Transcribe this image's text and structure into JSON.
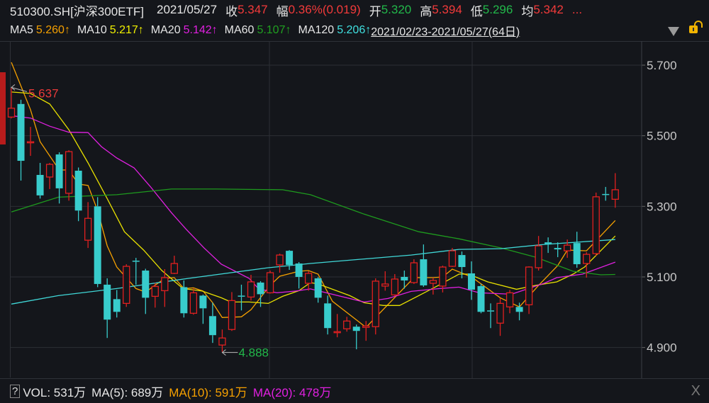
{
  "header": {
    "symbol": "510300.SH[沪深300ETF]",
    "date": "2021/05/27",
    "close_label": "收",
    "close": "5.347",
    "change_label": "幅",
    "change": "0.36%(0.019)",
    "open_label": "开",
    "open": "5.320",
    "high_label": "高",
    "high": "5.394",
    "low_label": "低",
    "low": "5.296",
    "avg_label": "均",
    "avg": "5.342",
    "more": "..."
  },
  "ma_legend": [
    {
      "label": "MA5",
      "value": "5.260↑",
      "color": "#f5a000"
    },
    {
      "label": "MA10",
      "value": "5.217↑",
      "color": "#f0f000"
    },
    {
      "label": "MA20",
      "value": "5.142↑",
      "color": "#e020e0"
    },
    {
      "label": "MA60",
      "value": "5.107↑",
      "color": "#20a020"
    },
    {
      "label": "MA120",
      "value": "5.206↑",
      "color": "#40e0e0"
    }
  ],
  "range": "2021/02/23-2021/05/27(64日)",
  "volume": {
    "help": "?",
    "vol": "VOL: 531万",
    "ma5": "MA(5): 689万",
    "ma10": "MA(10): 591万",
    "ma20": "MA(20): 478万",
    "close": "X"
  },
  "chart_data": {
    "type": "candlestick",
    "ylim": [
      4.83,
      5.77
    ],
    "yticks": [
      "5.700",
      "5.500",
      "5.300",
      "5.100",
      "4.900"
    ],
    "ytick_values": [
      5.7,
      5.5,
      5.3,
      5.1,
      4.9
    ],
    "annotations": {
      "max": "5.637",
      "min": "4.888",
      "max_index": 0,
      "min_index": 22
    },
    "up_color": "#e02020",
    "down_color": "#38cccc",
    "candles": [
      [
        5.553,
        5.637,
        5.549,
        5.578
      ],
      [
        5.59,
        5.602,
        5.373,
        5.429
      ],
      [
        5.483,
        5.525,
        5.443,
        5.483
      ],
      [
        5.389,
        5.423,
        5.322,
        5.331
      ],
      [
        5.383,
        5.423,
        5.349,
        5.419
      ],
      [
        5.447,
        5.453,
        5.308,
        5.351
      ],
      [
        5.337,
        5.459,
        5.316,
        5.455
      ],
      [
        5.401,
        5.41,
        5.258,
        5.288
      ],
      [
        5.204,
        5.312,
        5.182,
        5.266
      ],
      [
        5.3,
        5.326,
        5.071,
        5.08
      ],
      [
        5.078,
        5.096,
        4.927,
        4.979
      ],
      [
        5.037,
        5.063,
        4.985,
        5.001
      ],
      [
        5.025,
        5.136,
        5.015,
        5.13
      ],
      [
        5.146,
        5.154,
        5.078,
        5.144
      ],
      [
        5.118,
        5.123,
        4.995,
        5.041
      ],
      [
        5.045,
        5.083,
        5.013,
        5.073
      ],
      [
        5.061,
        5.122,
        5.015,
        5.098
      ],
      [
        5.11,
        5.16,
        5.108,
        5.138
      ],
      [
        5.071,
        5.09,
        4.985,
        4.997
      ],
      [
        4.997,
        5.067,
        4.993,
        5.055
      ],
      [
        5.047,
        5.05,
        4.967,
        5.011
      ],
      [
        4.989,
        5.027,
        4.913,
        4.935
      ],
      [
        4.907,
        4.951,
        4.888,
        4.927
      ],
      [
        4.951,
        5.057,
        4.947,
        5.033
      ],
      [
        5.047,
        5.078,
        5.005,
        5.045
      ],
      [
        5.043,
        5.106,
        5.033,
        5.086
      ],
      [
        5.084,
        5.088,
        5.015,
        5.051
      ],
      [
        5.055,
        5.118,
        5.053,
        5.112
      ],
      [
        5.134,
        5.166,
        5.112,
        5.162
      ],
      [
        5.174,
        5.176,
        5.12,
        5.134
      ],
      [
        5.138,
        5.142,
        5.067,
        5.1
      ],
      [
        5.082,
        5.116,
        5.061,
        5.11
      ],
      [
        5.096,
        5.1,
        5.027,
        5.041
      ],
      [
        5.025,
        5.047,
        4.937,
        4.955
      ],
      [
        4.943,
        4.995,
        4.929,
        4.945
      ],
      [
        4.953,
        4.987,
        4.945,
        4.975
      ],
      [
        4.959,
        4.965,
        4.895,
        4.947
      ],
      [
        4.957,
        4.975,
        4.919,
        4.961
      ],
      [
        4.959,
        5.096,
        4.937,
        5.088
      ],
      [
        5.074,
        5.116,
        5.061,
        5.08
      ],
      [
        5.049,
        5.108,
        5.045,
        5.094
      ],
      [
        5.1,
        5.118,
        5.067,
        5.09
      ],
      [
        5.084,
        5.15,
        5.08,
        5.14
      ],
      [
        5.15,
        5.192,
        5.072,
        5.076
      ],
      [
        5.082,
        5.098,
        5.05,
        5.09
      ],
      [
        5.074,
        5.132,
        5.056,
        5.128
      ],
      [
        5.13,
        5.182,
        5.128,
        5.174
      ],
      [
        5.162,
        5.172,
        5.096,
        5.128
      ],
      [
        5.11,
        5.144,
        5.035,
        5.064
      ],
      [
        5.074,
        5.08,
        4.997,
        5.001
      ],
      [
        5.005,
        5.025,
        4.955,
        5.003
      ],
      [
        4.969,
        5.04,
        4.933,
        5.025
      ],
      [
        5.015,
        5.063,
        4.997,
        5.055
      ],
      [
        5.015,
        5.027,
        4.977,
        5.001
      ],
      [
        5.021,
        5.13,
        4.995,
        5.128
      ],
      [
        5.126,
        5.216,
        5.118,
        5.188
      ],
      [
        5.198,
        5.212,
        5.168,
        5.192
      ],
      [
        5.182,
        5.198,
        5.156,
        5.178
      ],
      [
        5.174,
        5.206,
        5.154,
        5.19
      ],
      [
        5.196,
        5.228,
        5.126,
        5.136
      ],
      [
        5.138,
        5.17,
        5.098,
        5.164
      ],
      [
        5.166,
        5.339,
        5.16,
        5.327
      ],
      [
        5.335,
        5.355,
        5.316,
        5.333
      ],
      [
        5.32,
        5.394,
        5.296,
        5.347
      ]
    ],
    "ma_series": [
      {
        "name": "MA5",
        "color": "#f5a000",
        "points": [
          [
            0,
            5.708
          ],
          [
            2,
            5.574
          ],
          [
            3,
            5.483
          ],
          [
            5,
            5.403
          ],
          [
            6,
            5.403
          ],
          [
            7,
            5.363
          ],
          [
            8,
            5.359
          ],
          [
            9,
            5.288
          ],
          [
            10,
            5.188
          ],
          [
            11,
            5.128
          ],
          [
            13,
            5.067
          ],
          [
            14,
            5.057
          ],
          [
            16,
            5.096
          ],
          [
            17,
            5.098
          ],
          [
            18,
            5.067
          ],
          [
            19,
            5.069
          ],
          [
            20,
            5.06
          ],
          [
            21,
            5.027
          ],
          [
            22,
            4.985
          ],
          [
            24,
            4.987
          ],
          [
            25,
            5.007
          ],
          [
            27,
            5.076
          ],
          [
            28,
            5.102
          ],
          [
            30,
            5.116
          ],
          [
            31,
            5.118
          ],
          [
            32,
            5.108
          ],
          [
            33.5,
            5.031
          ],
          [
            37,
            4.957
          ],
          [
            42,
            5.098
          ],
          [
            44,
            5.098
          ],
          [
            45,
            5.1
          ],
          [
            46,
            5.122
          ],
          [
            48,
            5.1
          ],
          [
            51,
            5.041
          ],
          [
            53,
            5.015
          ],
          [
            55,
            5.076
          ],
          [
            57,
            5.132
          ],
          [
            58,
            5.176
          ],
          [
            60,
            5.174
          ],
          [
            63,
            5.26
          ]
        ]
      },
      {
        "name": "MA10",
        "color": "#e8e000",
        "points": [
          [
            0,
            5.624
          ],
          [
            2,
            5.62
          ],
          [
            4,
            5.59
          ],
          [
            6,
            5.517
          ],
          [
            8,
            5.423
          ],
          [
            10,
            5.322
          ],
          [
            11.8,
            5.228
          ],
          [
            13.8,
            5.176
          ],
          [
            15.7,
            5.118
          ],
          [
            17.9,
            5.067
          ],
          [
            19.9,
            5.06
          ],
          [
            21.9,
            5.041
          ],
          [
            22.9,
            5.029
          ],
          [
            24.8,
            5.029
          ],
          [
            26.8,
            5.025
          ],
          [
            28.3,
            5.045
          ],
          [
            30,
            5.061
          ],
          [
            31.2,
            5.084
          ],
          [
            32,
            5.08
          ],
          [
            35.3,
            5.047
          ],
          [
            36.8,
            5.027
          ],
          [
            38.8,
            5.019
          ],
          [
            40.5,
            5.019
          ],
          [
            42.5,
            5.047
          ],
          [
            44.7,
            5.078
          ],
          [
            46.7,
            5.108
          ],
          [
            47.7,
            5.108
          ],
          [
            49.7,
            5.086
          ],
          [
            52.7,
            5.065
          ],
          [
            54.7,
            5.076
          ],
          [
            56.9,
            5.086
          ],
          [
            58.6,
            5.108
          ],
          [
            59.8,
            5.128
          ],
          [
            63,
            5.216
          ]
        ]
      },
      {
        "name": "MA20",
        "color": "#e020e0",
        "points": [
          [
            0,
            5.557
          ],
          [
            2,
            5.55
          ],
          [
            4,
            5.527
          ],
          [
            6,
            5.51
          ],
          [
            8,
            5.509
          ],
          [
            9.4,
            5.469
          ],
          [
            11,
            5.437
          ],
          [
            12.8,
            5.409
          ],
          [
            14.5,
            5.356
          ],
          [
            16.7,
            5.282
          ],
          [
            18.2,
            5.236
          ],
          [
            20.1,
            5.182
          ],
          [
            21.9,
            5.136
          ],
          [
            24.8,
            5.096
          ],
          [
            25.8,
            5.066
          ],
          [
            27.7,
            5.055
          ],
          [
            29.7,
            5.06
          ],
          [
            31.2,
            5.066
          ],
          [
            36.8,
            5.029
          ],
          [
            39.3,
            5.039
          ],
          [
            41.7,
            5.059
          ],
          [
            44.7,
            5.067
          ],
          [
            46.7,
            5.071
          ],
          [
            48.8,
            5.055
          ],
          [
            52.2,
            5.051
          ],
          [
            55.6,
            5.082
          ],
          [
            56.9,
            5.098
          ],
          [
            59.6,
            5.108
          ],
          [
            63,
            5.142
          ]
        ]
      },
      {
        "name": "MA60",
        "color": "#1e9a1e",
        "points": [
          [
            0,
            5.284
          ],
          [
            4.9,
            5.326
          ],
          [
            11,
            5.333
          ],
          [
            16.7,
            5.349
          ],
          [
            21.4,
            5.349
          ],
          [
            28.3,
            5.347
          ],
          [
            31.2,
            5.333
          ],
          [
            36.8,
            5.278
          ],
          [
            42.5,
            5.228
          ],
          [
            46.7,
            5.208
          ],
          [
            51.1,
            5.182
          ],
          [
            54.7,
            5.156
          ],
          [
            58.6,
            5.116
          ],
          [
            61.5,
            5.106
          ],
          [
            63,
            5.107
          ]
        ]
      },
      {
        "name": "MA120",
        "color": "#40d8d8",
        "points": [
          [
            0,
            5.023
          ],
          [
            4.9,
            5.047
          ],
          [
            11,
            5.067
          ],
          [
            18.5,
            5.096
          ],
          [
            26.8,
            5.126
          ],
          [
            31.2,
            5.138
          ],
          [
            41.7,
            5.162
          ],
          [
            46.7,
            5.178
          ],
          [
            51.1,
            5.18
          ],
          [
            55.6,
            5.192
          ],
          [
            63,
            5.206
          ]
        ]
      }
    ]
  }
}
